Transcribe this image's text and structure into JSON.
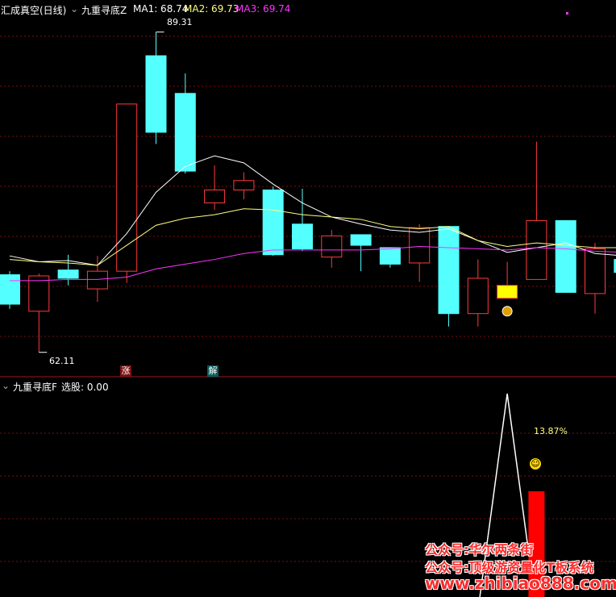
{
  "window": {
    "title": "汇成真空(日线)",
    "indicator_main": "九重寻底Z",
    "ma1_label": "MA1: 68.74",
    "ma2_label": "MA2: 69.73",
    "ma3_label": "MA3: 69.74",
    "indicator_sub": "九重寻底F",
    "sub_value_label": "选股: 0.00"
  },
  "colors": {
    "bg": "#000000",
    "grid": "#7a1010",
    "up": "#ff3b3b",
    "down": "#54ffff",
    "ma1": "#ffffff",
    "ma2": "#ffff80",
    "ma3": "#ff33ff",
    "bar": "#ff0000",
    "highlight": "#ffff00"
  },
  "annotations": {
    "high_label": "89.31",
    "low_label": "62.11",
    "signal_up": "涨",
    "signal_release": "解",
    "pct_label": "13.87%"
  },
  "watermark": {
    "line1": "公众号:华尔两条街",
    "line2": "公众号:顶级游资量化T板系统",
    "line3": "www.zhibiao888.com"
  },
  "chart_data": [
    {
      "type": "candlestick",
      "title": "九重寻底Z",
      "ylim": [
        61.2,
        90.8
      ],
      "series": [
        {
          "name": "K",
          "candles": [
            {
              "o": 68.7,
              "c": 66.2,
              "h": 69.0,
              "l": 65.8,
              "dir": "down"
            },
            {
              "o": 65.6,
              "c": 68.6,
              "h": 68.8,
              "l": 62.11,
              "dir": "up"
            },
            {
              "o": 69.1,
              "c": 68.4,
              "h": 70.4,
              "l": 67.8,
              "dir": "down"
            },
            {
              "o": 67.5,
              "c": 69.0,
              "h": 70.3,
              "l": 66.4,
              "dir": "up"
            },
            {
              "o": 69.0,
              "c": 83.2,
              "h": 83.2,
              "l": 68.0,
              "dir": "up"
            },
            {
              "o": 87.3,
              "c": 80.8,
              "h": 89.31,
              "l": 79.8,
              "dir": "down"
            },
            {
              "o": 84.1,
              "c": 77.5,
              "h": 85.8,
              "l": 77.3,
              "dir": "down"
            },
            {
              "o": 74.8,
              "c": 75.9,
              "h": 78.0,
              "l": 74.2,
              "dir": "up"
            },
            {
              "o": 75.9,
              "c": 76.7,
              "h": 77.4,
              "l": 75.1,
              "dir": "up"
            },
            {
              "o": 75.9,
              "c": 70.4,
              "h": 76.2,
              "l": 70.3,
              "dir": "down"
            },
            {
              "o": 73.0,
              "c": 70.9,
              "h": 76.0,
              "l": 70.7,
              "dir": "down"
            },
            {
              "o": 70.2,
              "c": 72.0,
              "h": 72.5,
              "l": 69.3,
              "dir": "up"
            },
            {
              "o": 72.1,
              "c": 71.2,
              "h": 72.1,
              "l": 69.0,
              "dir": "down"
            },
            {
              "o": 71.0,
              "c": 69.6,
              "h": 71.0,
              "l": 69.3,
              "dir": "down"
            },
            {
              "o": 69.7,
              "c": 72.7,
              "h": 73.0,
              "l": 68.1,
              "dir": "up"
            },
            {
              "o": 72.8,
              "c": 65.4,
              "h": 72.8,
              "l": 64.3,
              "dir": "down"
            },
            {
              "o": 65.4,
              "c": 68.4,
              "h": 70.0,
              "l": 64.3,
              "dir": "up"
            },
            {
              "o": 66.7,
              "c": 67.8,
              "h": 69.8,
              "l": 66.7,
              "dir": "up"
            },
            {
              "o": 68.3,
              "c": 73.3,
              "h": 80.0,
              "l": 68.3,
              "dir": "up"
            },
            {
              "o": 73.3,
              "c": 67.2,
              "h": 73.3,
              "l": 67.2,
              "dir": "down"
            },
            {
              "o": 67.1,
              "c": 70.9,
              "h": 71.4,
              "l": 65.4,
              "dir": "up"
            },
            {
              "o": 70.0,
              "c": 68.9,
              "h": 70.0,
              "l": 68.4,
              "dir": "down"
            }
          ]
        },
        {
          "name": "MA1",
          "values": [
            70.3,
            69.8,
            69.9,
            69.5,
            72.2,
            75.7,
            77.9,
            78.8,
            78.2,
            76.4,
            74.8,
            73.6,
            73.0,
            72.5,
            72.3,
            72.6,
            71.6,
            70.6,
            71.0,
            71.4,
            70.5,
            70.3
          ]
        },
        {
          "name": "MA2",
          "values": [
            70.0,
            69.8,
            69.7,
            69.5,
            71.2,
            72.9,
            73.5,
            73.8,
            74.3,
            74.2,
            73.8,
            73.6,
            73.4,
            72.8,
            72.6,
            72.8,
            71.6,
            71.1,
            71.4,
            71.2,
            71.0,
            71.0
          ]
        },
        {
          "name": "MA3",
          "values": [
            68.2,
            68.2,
            68.3,
            68.3,
            68.5,
            69.2,
            69.6,
            70.0,
            70.5,
            70.8,
            70.8,
            70.8,
            70.8,
            70.9,
            71.1,
            71.0,
            70.9,
            70.8,
            71.0,
            70.9,
            70.7,
            70.6
          ]
        }
      ],
      "signals": [
        {
          "index": 3,
          "text": "涨"
        },
        {
          "index": 7,
          "text": "解"
        },
        {
          "index": 17,
          "text": "money-bag-icon"
        }
      ]
    },
    {
      "type": "bar",
      "title": "九重寻底F",
      "ylim": [
        0,
        100
      ],
      "series": [
        {
          "name": "line",
          "values": [
            0,
            0,
            0,
            0,
            0,
            0,
            0,
            0,
            0,
            0,
            0,
            0,
            0,
            0,
            0,
            0,
            0,
            100,
            0,
            0,
            0,
            0
          ]
        },
        {
          "name": "bar",
          "values": [
            0,
            0,
            0,
            0,
            0,
            0,
            0,
            0,
            0,
            0,
            0,
            0,
            0,
            0,
            0,
            0,
            0,
            0,
            52,
            0,
            0,
            0
          ]
        }
      ]
    }
  ]
}
